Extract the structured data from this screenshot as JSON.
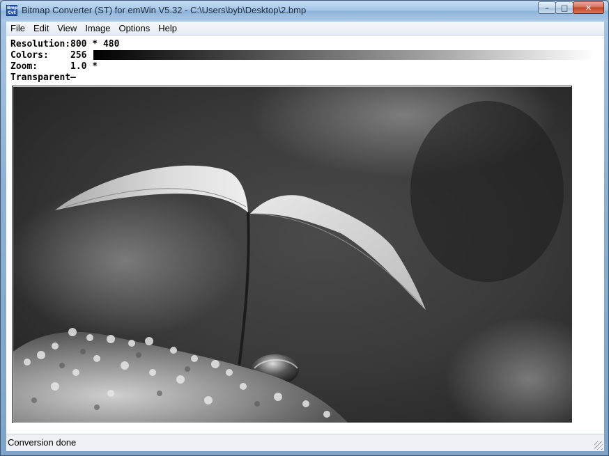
{
  "window": {
    "title": "Bitmap Converter (ST) for emWin V5.32 - C:\\Users\\byb\\Desktop\\2.bmp",
    "icon_text": "Bmp Cvt",
    "minimize_glyph": "–",
    "maximize_glyph": "□",
    "close_glyph": "✕"
  },
  "menu": {
    "items": [
      "File",
      "Edit",
      "View",
      "Image",
      "Options",
      "Help"
    ]
  },
  "info": {
    "resolution_label": "Resolution:",
    "resolution_value": "800 * 480",
    "colors_label": "Colors:",
    "colors_value": "256",
    "zoom_label": "Zoom:",
    "zoom_value": "1.0 *",
    "transparent_label": "Transparent",
    "transparent_value": "—"
  },
  "status": {
    "text": "Conversion done"
  }
}
